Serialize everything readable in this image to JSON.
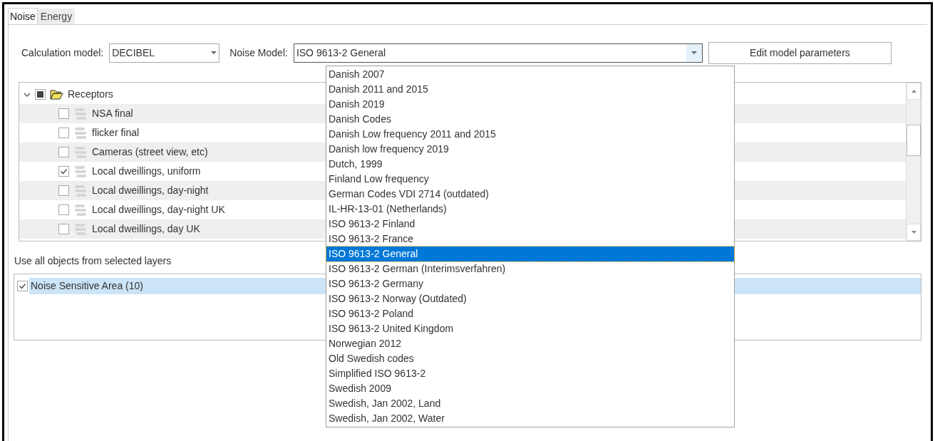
{
  "tabs": [
    {
      "label": "Noise",
      "selected": true
    },
    {
      "label": "Energy",
      "selected": false
    }
  ],
  "calculation_model": {
    "label": "Calculation model:",
    "value": "DECIBEL"
  },
  "noise_model": {
    "label": "Noise Model:",
    "value": "ISO 9613-2 General",
    "expanded": true
  },
  "edit_button": "Edit model parameters",
  "tree": [
    {
      "label": "Receptors",
      "expanded": true,
      "indeterminate": true,
      "children": [
        {
          "label": "NSA final",
          "checked": false
        },
        {
          "label": "flicker final",
          "checked": false
        },
        {
          "label": "Cameras (street view, etc)",
          "checked": false
        },
        {
          "label": "Local dweillings, uniform",
          "checked": true
        },
        {
          "label": "Local dweillings, day-night",
          "checked": false
        },
        {
          "label": "Local dweillings, day-night UK",
          "checked": false
        },
        {
          "label": "Local dweillings, day UK",
          "checked": false
        }
      ]
    }
  ],
  "layers_label": "Use all objects from selected layers",
  "layers": [
    {
      "label": "Noise Sensitive Area (10)",
      "checked": true,
      "selected": true
    }
  ],
  "dropdown_options": [
    {
      "label": "Danish 2007",
      "selected": false
    },
    {
      "label": "Danish 2011 and 2015",
      "selected": false
    },
    {
      "label": "Danish 2019",
      "selected": false
    },
    {
      "label": "Danish Codes",
      "selected": false
    },
    {
      "label": "Danish Low frequency 2011 and 2015",
      "selected": false
    },
    {
      "label": "Danish low frequency 2019",
      "selected": false
    },
    {
      "label": "Dutch, 1999",
      "selected": false
    },
    {
      "label": "Finland Low frequency",
      "selected": false
    },
    {
      "label": "German Codes VDI 2714 (outdated)",
      "selected": false
    },
    {
      "label": "IL-HR-13-01 (Netherlands)",
      "selected": false
    },
    {
      "label": "ISO 9613-2 Finland",
      "selected": false
    },
    {
      "label": "ISO 9613-2 France",
      "selected": false
    },
    {
      "label": "ISO 9613-2 General",
      "selected": true
    },
    {
      "label": "ISO 9613-2 German (Interimsverfahren)",
      "selected": false
    },
    {
      "label": "ISO 9613-2 Germany",
      "selected": false
    },
    {
      "label": "ISO 9613-2 Norway (Outdated)",
      "selected": false
    },
    {
      "label": "ISO 9613-2 Poland",
      "selected": false
    },
    {
      "label": "ISO 9613-2 United Kingdom",
      "selected": false
    },
    {
      "label": "Norwegian 2012",
      "selected": false
    },
    {
      "label": "Old Swedish codes",
      "selected": false
    },
    {
      "label": "Simplified ISO 9613-2",
      "selected": false
    },
    {
      "label": "Swedish 2009",
      "selected": false
    },
    {
      "label": "Swedish, Jan 2002, Land",
      "selected": false
    },
    {
      "label": "Swedish, Jan 2002, Water",
      "selected": false
    }
  ]
}
